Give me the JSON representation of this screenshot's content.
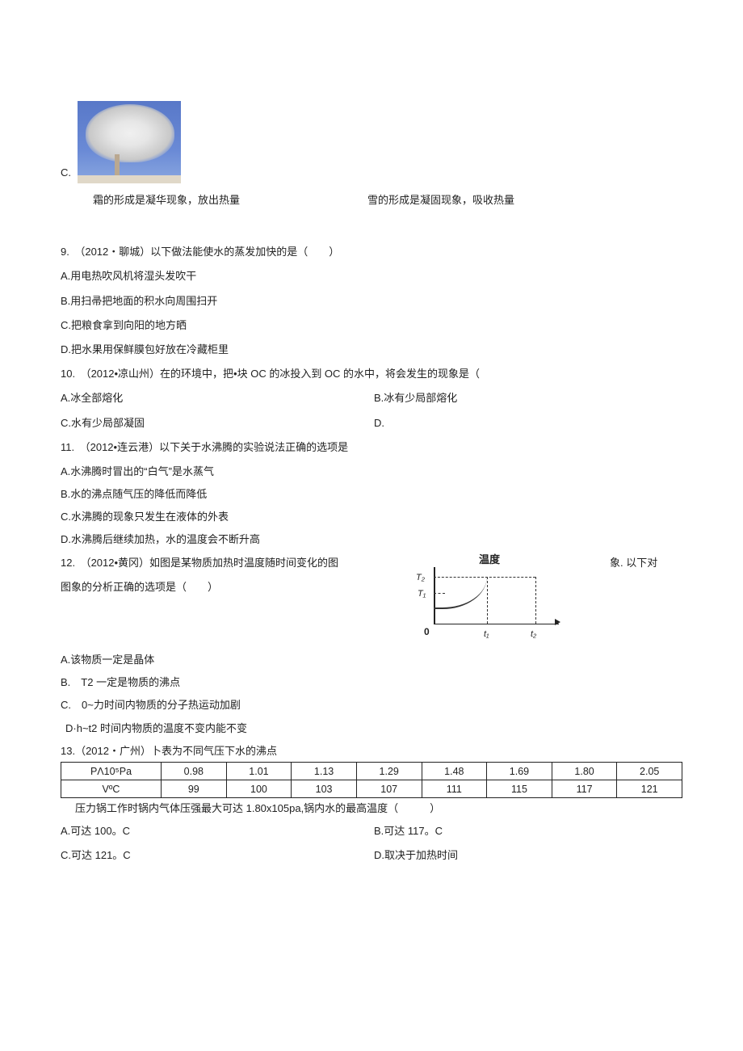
{
  "optionC_letter": "C.",
  "caption_left": "霜的形成是凝华现象，放出热量",
  "caption_right": "雪的形成是凝固现象，吸收热量",
  "q9": {
    "stem": "9.　（2012・聊城）以下做法能使水的蒸发加快的是（　　）",
    "A": "A.用电热吹风机将湿头发吹干",
    "B": "B.用扫帚把地面的积水向周围扫开",
    "C": "C.把粮食拿到向阳的地方晒",
    "D": "D.把水果用保鲜膜包好放在冷藏柜里"
  },
  "q10": {
    "stem": "10.　（2012•凉山州）在的环境中，把•块 OC 的冰投入到 OC 的水中，将会发生的现象是（",
    "A": "A.冰全部熔化",
    "B": "B.冰有少局部熔化",
    "C": "C.水有少局部凝固",
    "D": "D."
  },
  "q11": {
    "stem": "11.　（2012•连云港）以下关于水沸腾的实验说法正确的选项是",
    "A": "A.水沸腾时冒出的“白气”是水蒸气",
    "B": "B.水的沸点随气压的降低而降低",
    "C": "C.水沸腾的现象只发生在液体的外表",
    "D": "D.水沸腾后继续加热，水的温度会不断升高"
  },
  "q12": {
    "stem_part1": "12.　（2012•黄冈）如图是某物质加热时温度随时间变化的图",
    "stem_part2": "图象的分析正确的选项是（　　）",
    "right_tail": "象. 以下对",
    "graph_label": "温度",
    "T2": "T₂",
    "T1": "T₁",
    "zero": "0",
    "t1": "t₁",
    "t2": "t₂",
    "A": "A.该物质一定是晶体",
    "B": "B.　T2 一定是物质的沸点",
    "C": "C.　0~力时间内物质的分子热运动加剧",
    "D": "D·h~t2 时间内物质的温度不变内能不变"
  },
  "q13": {
    "stem": "13.（2012・广州）卜表为不同气压下水的沸点",
    "row1_head": "PΛ10⁵Pa",
    "row2_head": " VºC",
    "row1": [
      "0.98",
      "1.01",
      "1.13",
      "1.29",
      "1.48",
      "1.69",
      "1.80",
      "2.05"
    ],
    "row2": [
      "99",
      "100",
      "103",
      "107",
      "111",
      "115",
      "117",
      "121"
    ],
    "after": "压力锅工作时锅内气体压强最大可达 1.80x105pa,锅内水的最高温度（　　　）",
    "A": "A.可达 100。C",
    "B": "B.可达 117。C",
    "C": "C.可达 121。C",
    "D": "D.取决于加热时间"
  }
}
